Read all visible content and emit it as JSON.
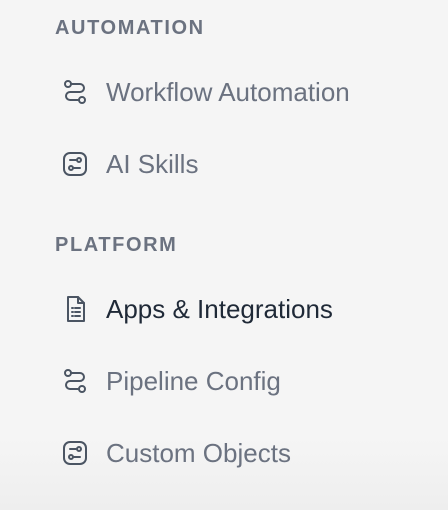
{
  "sidebar": {
    "sections": [
      {
        "title": "AUTOMATION",
        "items": [
          {
            "label": "Workflow Automation",
            "icon": "route-icon"
          },
          {
            "label": "AI Skills",
            "icon": "ai-skills-icon"
          }
        ]
      },
      {
        "title": "PLATFORM",
        "items": [
          {
            "label": "Apps & Integrations",
            "icon": "document-icon",
            "active": true
          },
          {
            "label": "Pipeline Config",
            "icon": "route-icon"
          },
          {
            "label": "Custom Objects",
            "icon": "custom-objects-icon"
          }
        ]
      }
    ]
  }
}
